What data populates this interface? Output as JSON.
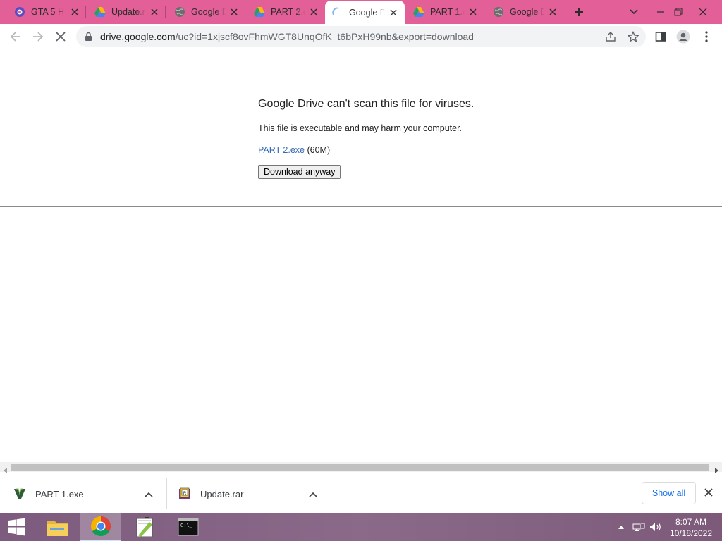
{
  "tabs": [
    {
      "title": "GTA 5 H",
      "favicon": "gta-icon",
      "active": false
    },
    {
      "title": "Update.r",
      "favicon": "google-drive-icon",
      "active": false
    },
    {
      "title": "Google D",
      "favicon": "globe-icon",
      "active": false
    },
    {
      "title": "PART 2.e",
      "favicon": "google-drive-icon",
      "active": false
    },
    {
      "title": "Google D",
      "favicon": "loading-spinner-icon",
      "active": true
    },
    {
      "title": "PART 1.e",
      "favicon": "google-drive-icon",
      "active": false
    },
    {
      "title": "Google D",
      "favicon": "globe-icon",
      "active": false
    }
  ],
  "toolbar": {
    "url_host": "drive.google.com",
    "url_rest": "/uc?id=1xjscf8ovFhmWGT8UnqOfK_t6bPxH99nb&export=download"
  },
  "page": {
    "heading": "Google Drive can't scan this file for viruses.",
    "message": "This file is executable and may harm your computer.",
    "file_link": "PART 2.exe",
    "file_size": " (60M)",
    "download_button": "Download anyway"
  },
  "downloads": {
    "items": [
      {
        "name": "PART 1.exe",
        "icon": "gta-v-icon"
      },
      {
        "name": "Update.rar",
        "icon": "winrar-icon"
      }
    ],
    "show_all": "Show all"
  },
  "taskbar": {
    "apps": [
      "file-explorer-icon",
      "chrome-icon",
      "notepad-plus-plus-icon",
      "command-prompt-icon"
    ],
    "time": "8:07 AM",
    "date": "10/18/2022"
  },
  "colors": {
    "tabstrip": "#e25f97",
    "link": "#3367b4",
    "accent": "#1a73e8"
  }
}
